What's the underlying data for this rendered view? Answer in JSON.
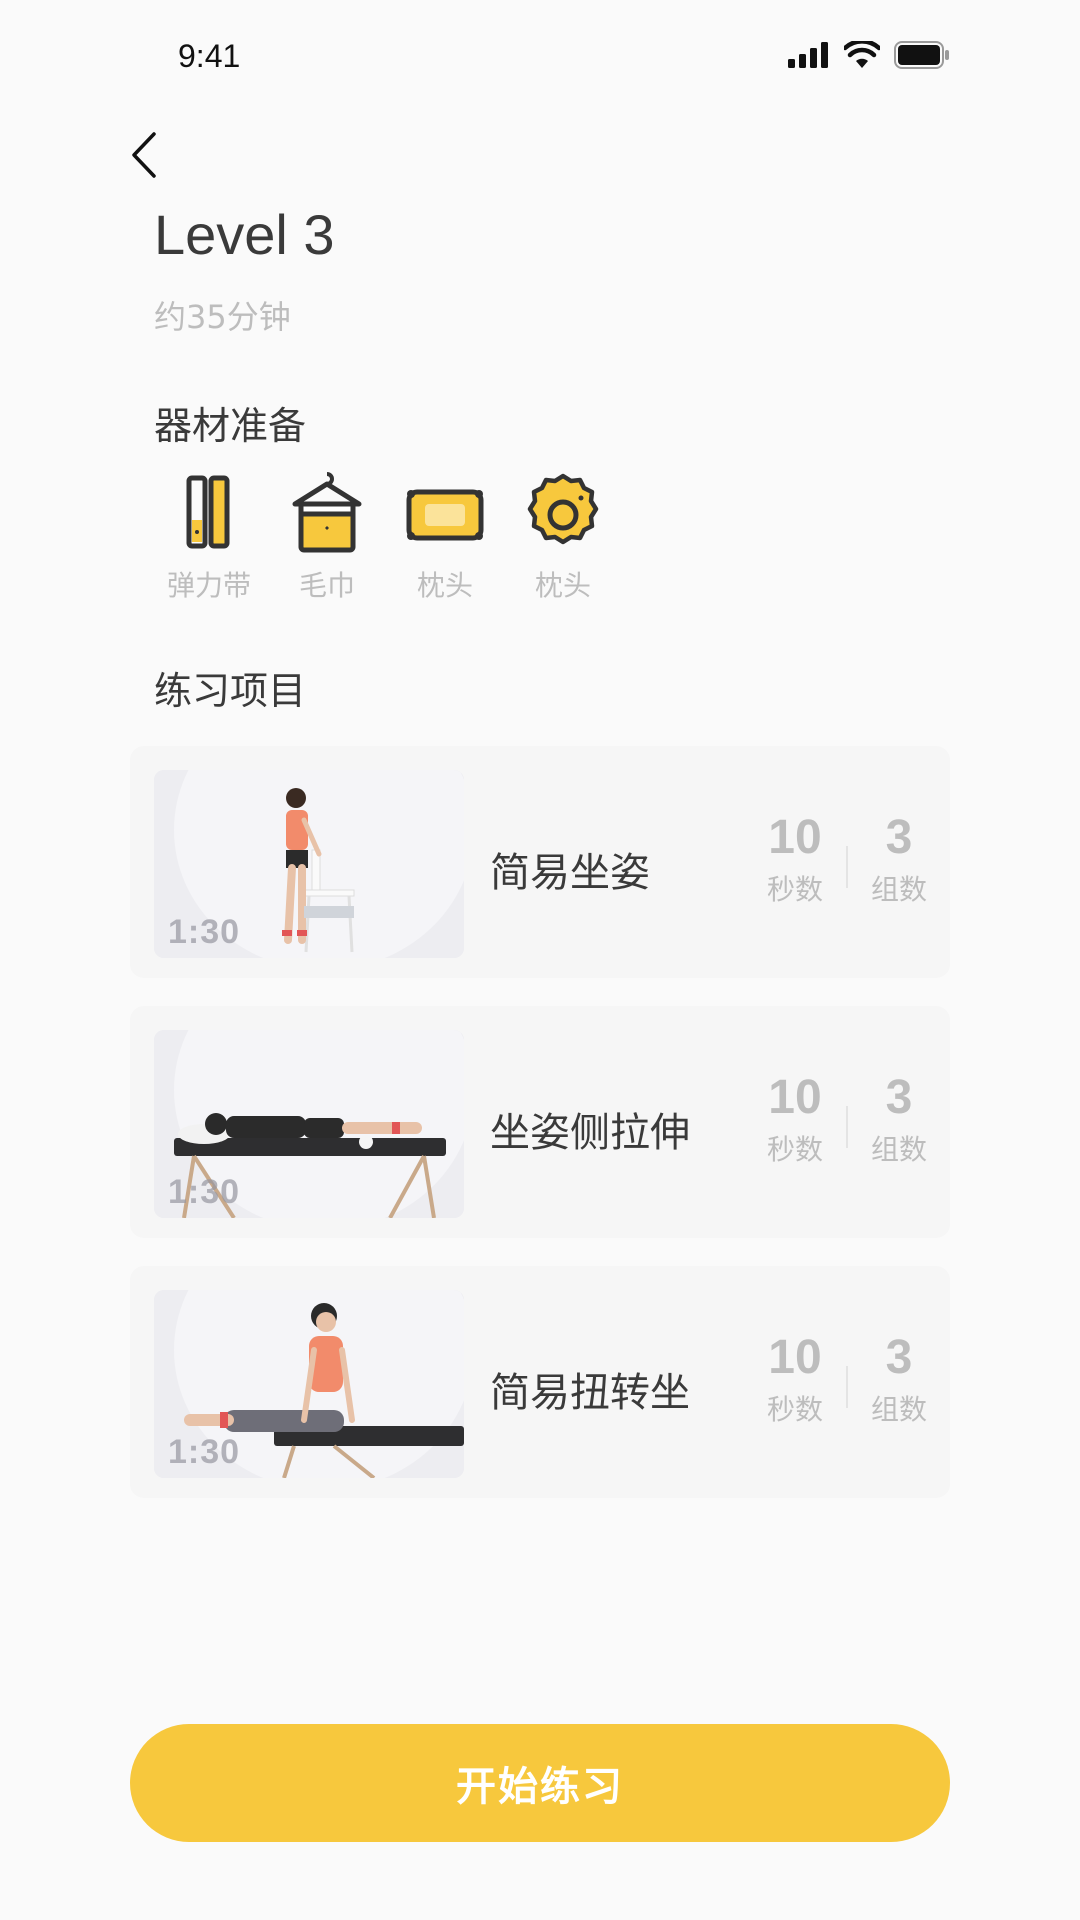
{
  "status_bar": {
    "time": "9:41"
  },
  "header": {
    "title": "Level 3",
    "duration": "约35分钟"
  },
  "equipment": {
    "title": "器材准备",
    "items": [
      {
        "label": "弹力带",
        "icon": "resistance-band-icon"
      },
      {
        "label": "毛巾",
        "icon": "towel-icon"
      },
      {
        "label": "枕头",
        "icon": "pillow-icon"
      },
      {
        "label": "枕头",
        "icon": "round-cushion-icon"
      }
    ]
  },
  "exercises": {
    "title": "练习项目",
    "items": [
      {
        "name": "简易坐姿",
        "video_time": "1:30",
        "seconds": "10",
        "seconds_label": "秒数",
        "sets": "3",
        "sets_label": "组数"
      },
      {
        "name": "坐姿侧拉伸",
        "video_time": "1:30",
        "seconds": "10",
        "seconds_label": "秒数",
        "sets": "3",
        "sets_label": "组数"
      },
      {
        "name": "简易扭转坐",
        "video_time": "1:30",
        "seconds": "10",
        "seconds_label": "秒数",
        "sets": "3",
        "sets_label": "组数"
      }
    ]
  },
  "start_button": {
    "label": "开始练习"
  },
  "colors": {
    "accent": "#F7C83D",
    "background": "#FAFAFA",
    "muted_text": "#BDBDBD"
  }
}
